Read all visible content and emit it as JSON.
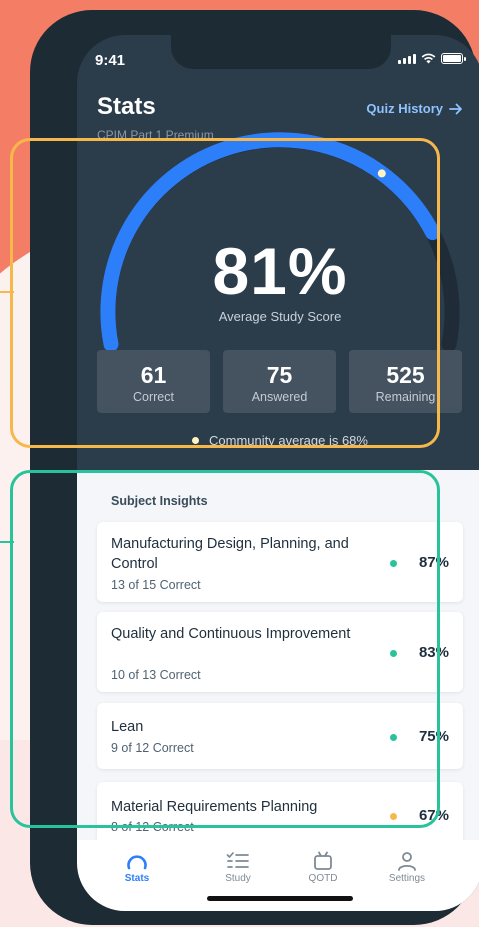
{
  "status_bar": {
    "time": "9:41"
  },
  "header": {
    "title": "Stats",
    "quiz_history_label": "Quiz History",
    "subtitle": "CPIM Part 1 Premium"
  },
  "score": {
    "value": "81%",
    "fraction": 0.81,
    "label": "Average Study Score",
    "community_fraction": 0.68
  },
  "stats": [
    {
      "value": "61",
      "label": "Correct"
    },
    {
      "value": "75",
      "label": "Answered"
    },
    {
      "value": "525",
      "label": "Remaining"
    }
  ],
  "community_text": "Community average is 68%",
  "insights": {
    "title": "Subject Insights",
    "items": [
      {
        "name": "Manufacturing Design, Planning, and Control",
        "sub": "13 of 15 Correct",
        "pct": "87%",
        "status": "green"
      },
      {
        "name": "Quality and Continuous Improvement",
        "sub": "10 of 13 Correct",
        "pct": "83%",
        "status": "green"
      },
      {
        "name": "Lean",
        "sub": "9 of 12 Correct",
        "pct": "75%",
        "status": "green"
      },
      {
        "name": "Material Requirements Planning",
        "sub": "8 of 12 Correct",
        "pct": "67%",
        "status": "orange"
      }
    ]
  },
  "tabs": [
    {
      "label": "Stats",
      "icon": "stats-gauge-icon",
      "active": true
    },
    {
      "label": "Study",
      "icon": "checklist-icon",
      "active": false
    },
    {
      "label": "QOTD",
      "icon": "calendar-icon",
      "active": false
    },
    {
      "label": "Settings",
      "icon": "person-icon",
      "active": false
    }
  ],
  "colors": {
    "accent": "#2d7ff9",
    "highlight_top": "#f7b84b",
    "highlight_bottom": "#28c39a",
    "status_green": "#28c39a",
    "status_orange": "#f7b84b",
    "community_dot": "#fff3c4"
  }
}
